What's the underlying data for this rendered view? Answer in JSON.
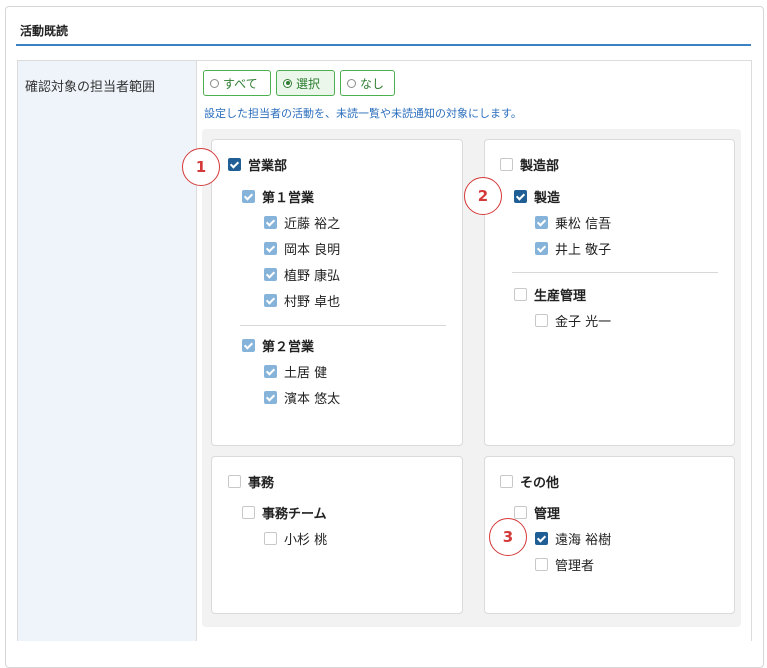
{
  "section": {
    "title": "活動既読"
  },
  "row": {
    "label": "確認対象の担当者範囲",
    "radios": [
      {
        "label": "すべて",
        "selected": false
      },
      {
        "label": "選択",
        "selected": true
      },
      {
        "label": "なし",
        "selected": false
      }
    ],
    "note": "設定した担当者の活動を、未読一覧や未読通知の対象にします。"
  },
  "groups": {
    "sales": {
      "name": "営業部",
      "checked": true,
      "teams": [
        {
          "name": "第１営業",
          "checked": true,
          "members": [
            {
              "name": "近藤 裕之",
              "checked": true
            },
            {
              "name": "岡本 良明",
              "checked": true
            },
            {
              "name": "植野 康弘",
              "checked": true
            },
            {
              "name": "村野 卓也",
              "checked": true
            }
          ]
        },
        {
          "name": "第２営業",
          "checked": true,
          "members": [
            {
              "name": "土居 健",
              "checked": true
            },
            {
              "name": "濱本 悠太",
              "checked": true
            }
          ]
        }
      ]
    },
    "manufacturing": {
      "name": "製造部",
      "checked": false,
      "teams": [
        {
          "name": "製造",
          "checked": true,
          "members": [
            {
              "name": "乗松 信吾",
              "checked": true
            },
            {
              "name": "井上 敬子",
              "checked": true
            }
          ]
        },
        {
          "name": "生産管理",
          "checked": false,
          "members": [
            {
              "name": "金子 光一",
              "checked": false
            }
          ]
        }
      ]
    },
    "office": {
      "name": "事務",
      "checked": false,
      "teams": [
        {
          "name": "事務チーム",
          "checked": false,
          "members": [
            {
              "name": "小杉 桃",
              "checked": false
            }
          ]
        }
      ]
    },
    "other": {
      "name": "その他",
      "checked": false,
      "teams": [
        {
          "name": "管理",
          "checked": false,
          "members": [
            {
              "name": "遠海 裕樹",
              "checked": true
            },
            {
              "name": "管理者",
              "checked": false
            }
          ]
        }
      ]
    }
  },
  "markers": [
    "1",
    "2",
    "3"
  ],
  "colors": {
    "accent": "#3b82c4",
    "checked": "#1f5f96",
    "checked_inherited": "#86b3d9",
    "radio_border": "#4caf50",
    "marker": "#d43a3a"
  }
}
